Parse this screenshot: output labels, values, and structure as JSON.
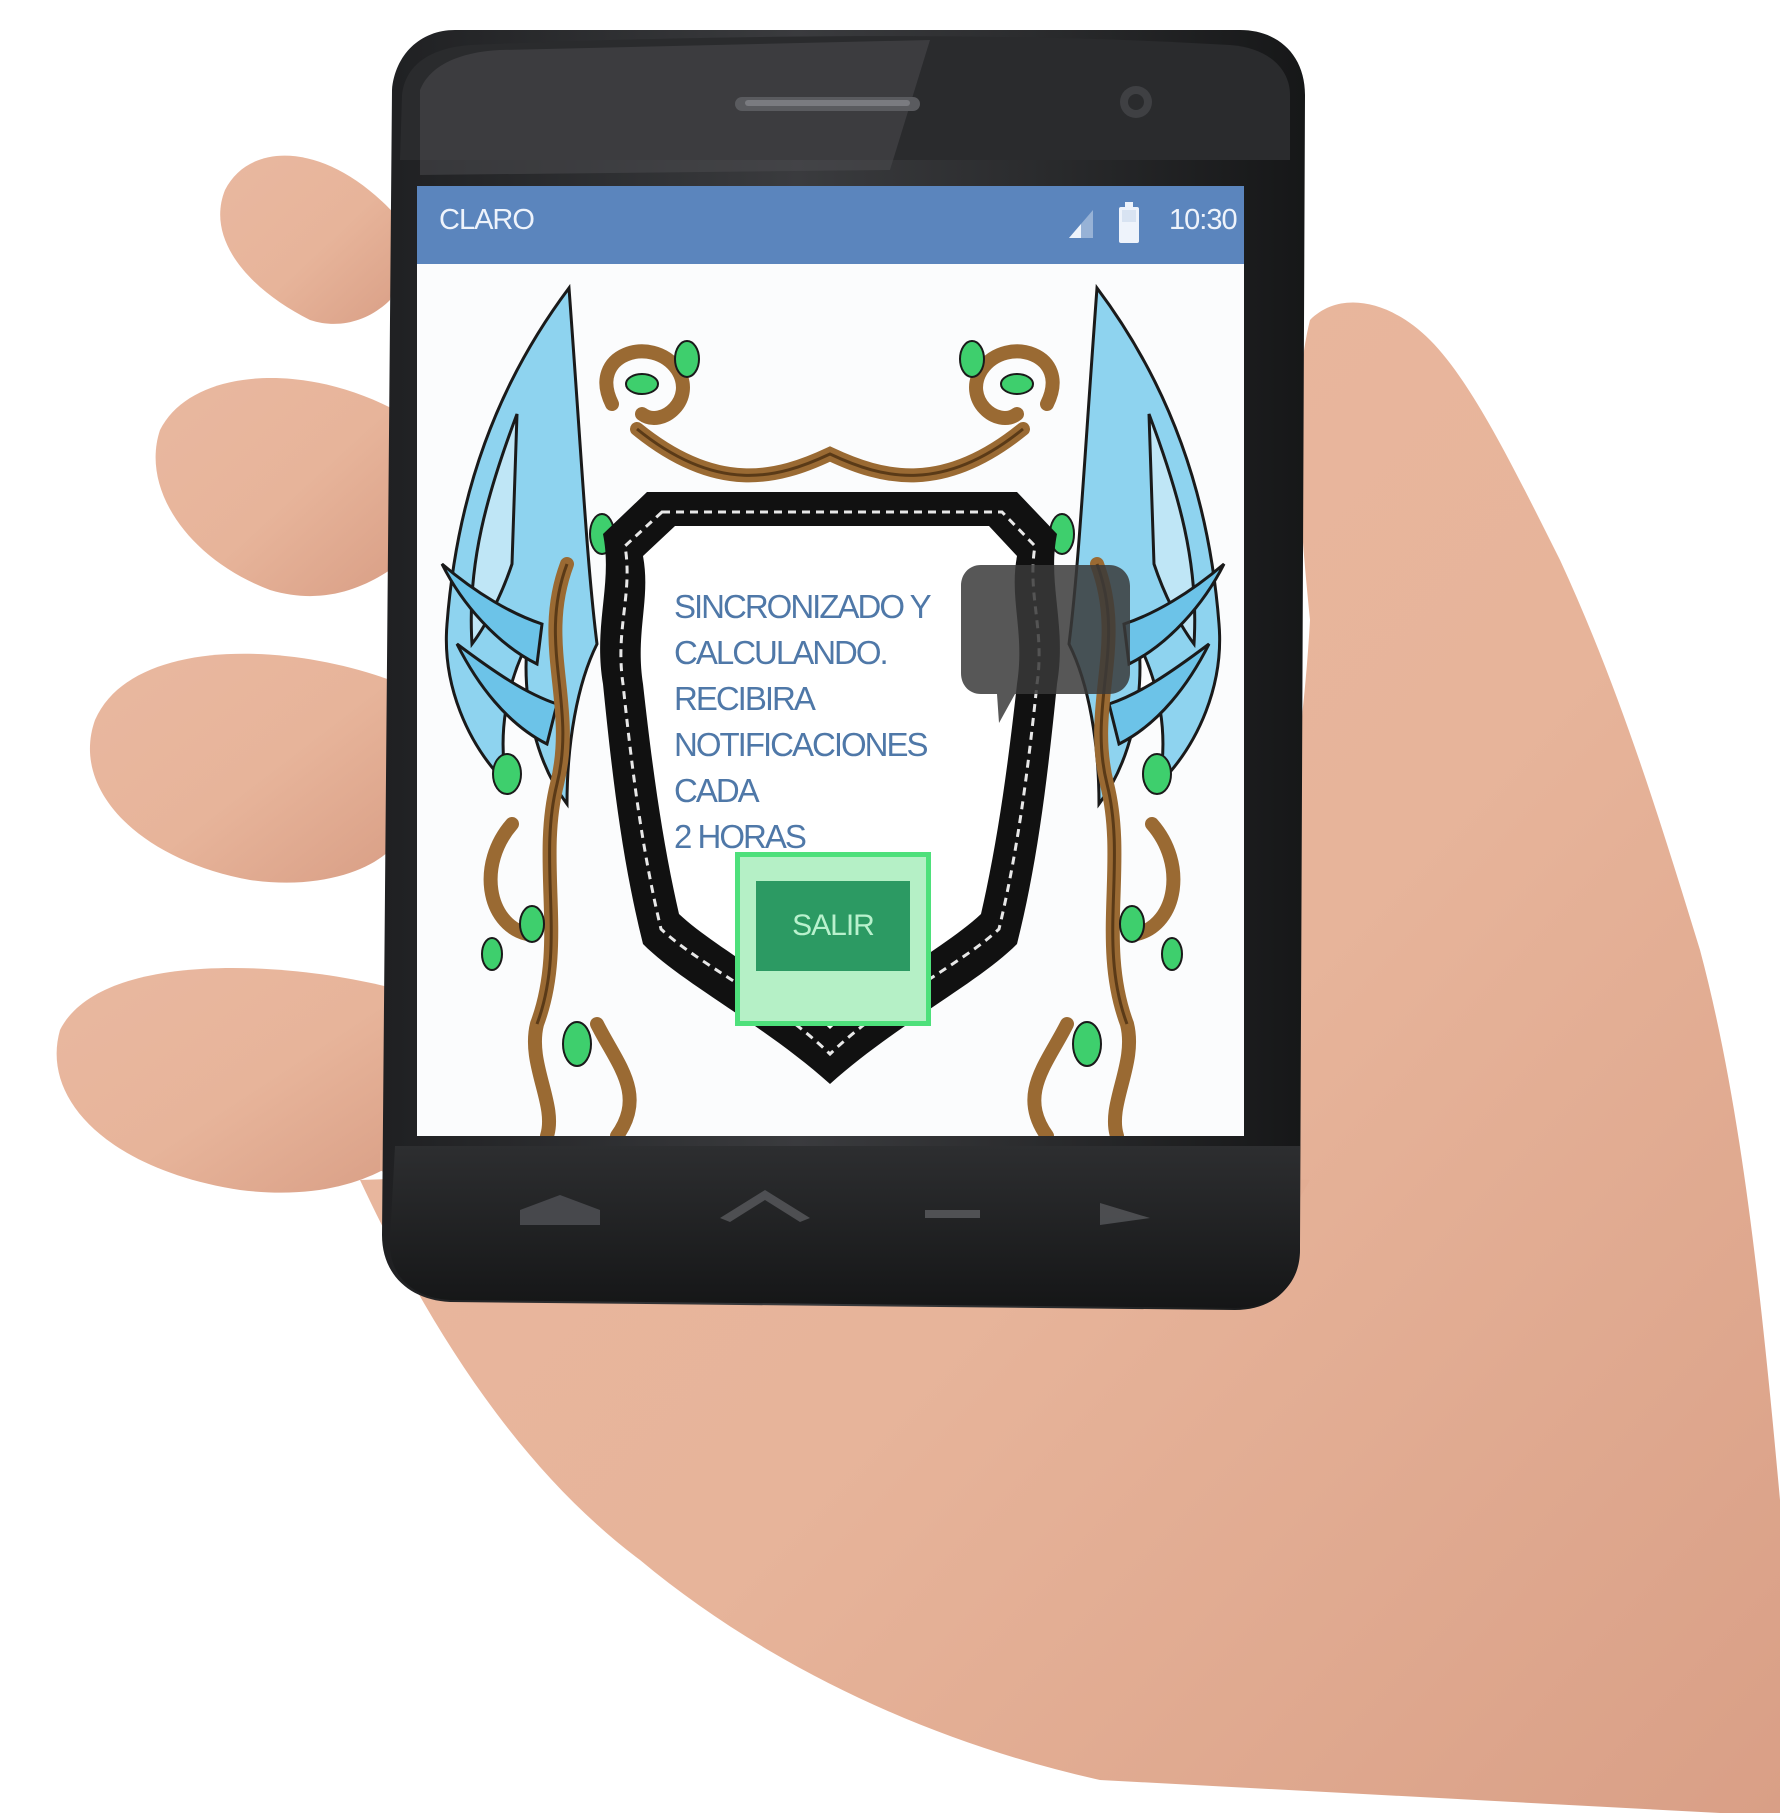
{
  "status_bar": {
    "carrier": "CLARO",
    "time": "10:30",
    "icons": [
      "signal-icon",
      "battery-icon"
    ]
  },
  "main": {
    "message_lines": [
      "SINCRONIZADO Y",
      "CALCULANDO.",
      "RECIBIRA",
      "NOTIFICACIONES CADA",
      "2 HORAS"
    ],
    "exit_label": "SALIR"
  },
  "colors": {
    "status_bar": "#5b85bd",
    "message_text": "#4f78a8",
    "button": "#2c9a63",
    "button_frame": "#4ee07b",
    "wing": "#8ed3ef",
    "vine": "#9a6a33",
    "leaf": "#3ecf6d"
  }
}
